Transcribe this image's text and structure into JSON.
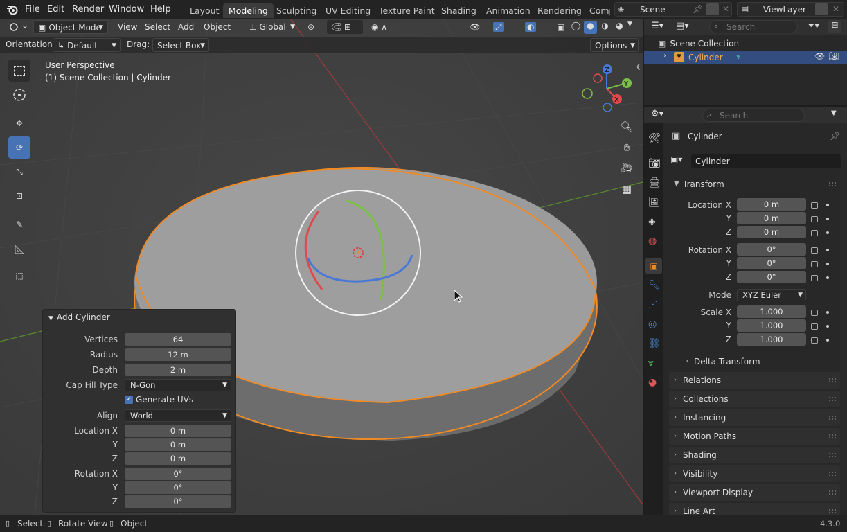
{
  "menu": [
    "File",
    "Edit",
    "Render",
    "Window",
    "Help"
  ],
  "workspaces": [
    "Layout",
    "Modeling",
    "Sculpting",
    "UV Editing",
    "Texture Paint",
    "Shading",
    "Animation",
    "Rendering",
    "Comp"
  ],
  "active_workspace": "Modeling",
  "scene": "Scene",
  "view_layer": "ViewLayer",
  "header": {
    "mode": "Object Mode",
    "view": "View",
    "select": "Select",
    "add": "Add",
    "object": "Object",
    "transform_orientation": "Global"
  },
  "toolsettings": {
    "orientation_label": "Orientation:",
    "orientation_value": "Default",
    "drag_label": "Drag:",
    "drag_value": "Select Box",
    "options": "Options"
  },
  "viewport": {
    "perspective": "User Perspective",
    "context": "(1) Scene Collection | Cylinder",
    "gizmo_axes": {
      "x": "X",
      "y": "Y",
      "z": "Z"
    }
  },
  "redo_panel": {
    "title": "Add Cylinder",
    "vertices_label": "Vertices",
    "vertices": "64",
    "radius_label": "Radius",
    "radius": "12 m",
    "depth_label": "Depth",
    "depth": "2 m",
    "cap_label": "Cap Fill Type",
    "cap": "N-Gon",
    "uvs_label": "Generate UVs",
    "align_label": "Align",
    "align": "World",
    "loc_label": "Location X",
    "loc_x": "0 m",
    "y_label": "Y",
    "loc_y": "0 m",
    "z_label": "Z",
    "loc_z": "0 m",
    "rot_label": "Rotation X",
    "rot_x": "0°",
    "rot_y": "0°",
    "rot_z": "0°"
  },
  "outliner": {
    "search_placeholder": "Search",
    "collection": "Scene Collection",
    "object": "Cylinder"
  },
  "properties": {
    "search_placeholder": "Search",
    "object_name": "Cylinder",
    "name_field": "Cylinder",
    "transform": "Transform",
    "location_label": "Location X",
    "y": "Y",
    "z": "Z",
    "loc_x": "0 m",
    "loc_y": "0 m",
    "loc_z": "0 m",
    "rotation_label": "Rotation X",
    "rot_x": "0°",
    "rot_y": "0°",
    "rot_z": "0°",
    "mode_label": "Mode",
    "mode": "XYZ Euler",
    "scale_label": "Scale X",
    "scale_x": "1.000",
    "scale_y": "1.000",
    "scale_z": "1.000",
    "delta": "Delta Transform",
    "panels": [
      "Relations",
      "Collections",
      "Instancing",
      "Motion Paths",
      "Shading",
      "Visibility",
      "Viewport Display",
      "Line Art"
    ]
  },
  "status": {
    "select": "Select",
    "rotate": "Rotate View",
    "object": "Object",
    "version": "4.3.0"
  }
}
